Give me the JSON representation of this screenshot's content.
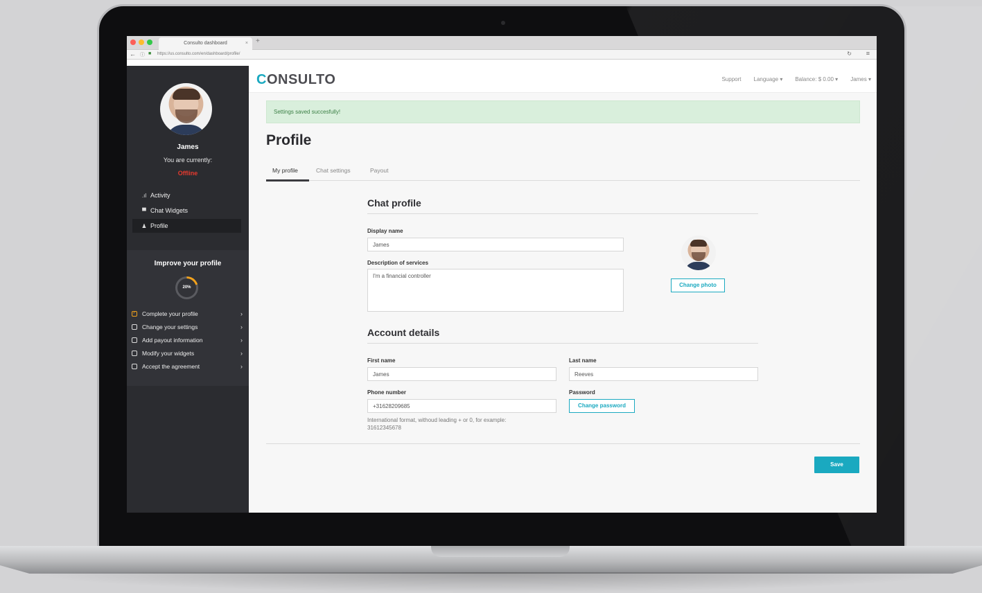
{
  "browser": {
    "tab_title": "Consulto dashboard",
    "tab_close": "×",
    "new_tab": "+",
    "url": "https://us.consulto.com/en/dashboard/profile/",
    "traffic_light_colors": [
      "#fc5f57",
      "#fdbc2e",
      "#34c84a"
    ]
  },
  "sidebar": {
    "user_name": "James",
    "status_prefix": "You are currently:",
    "status_value": "Offline",
    "nav": [
      {
        "icon": "bar-chart-icon",
        "glyph": ".ıl",
        "label": "Activity"
      },
      {
        "icon": "chat-bubble-icon",
        "glyph": "▀",
        "label": "Chat Widgets"
      },
      {
        "icon": "user-icon",
        "glyph": "♟",
        "label": "Profile",
        "active": true
      }
    ],
    "improve": {
      "title": "Improve your profile",
      "progress": 0.2,
      "progress_label": "20%",
      "tasks": [
        {
          "label": "Complete your profile",
          "done": true
        },
        {
          "label": "Change your settings",
          "done": false
        },
        {
          "label": "Add payout information",
          "done": false
        },
        {
          "label": "Modify your widgets",
          "done": false
        },
        {
          "label": "Accept the agreement",
          "done": false
        }
      ]
    }
  },
  "header": {
    "logo_first": "C",
    "logo_rest": "ONSULTO",
    "links": [
      "Support",
      "Language ▾",
      "Balance: $ 0.00 ▾",
      "James ▾"
    ]
  },
  "alert": {
    "text": "Settings saved succesfully!"
  },
  "page": {
    "title": "Profile",
    "tabs": [
      "My profile",
      "Chat settings",
      "Payout"
    ]
  },
  "chat_profile": {
    "title": "Chat profile",
    "display_name_label": "Display name",
    "display_name_value": "James",
    "description_label": "Description of services",
    "description_value": "I'm a financial controller",
    "change_photo_label": "Change photo"
  },
  "account": {
    "title": "Account details",
    "first_name_label": "First name",
    "first_name_value": "James",
    "last_name_label": "Last name",
    "last_name_value": "Reeves",
    "phone_label": "Phone number",
    "phone_value": "+31628209685",
    "phone_hint_line1": "International format, withoud leading + or 0, for example:",
    "phone_hint_line2": "31612345678",
    "password_label": "Password",
    "change_password_label": "Change password"
  },
  "save_label": "Save",
  "colors": {
    "accent": "#1aa9c0",
    "offline": "#e63a2e",
    "progress": "#f2a21c",
    "success_bg": "#d9efdc"
  }
}
